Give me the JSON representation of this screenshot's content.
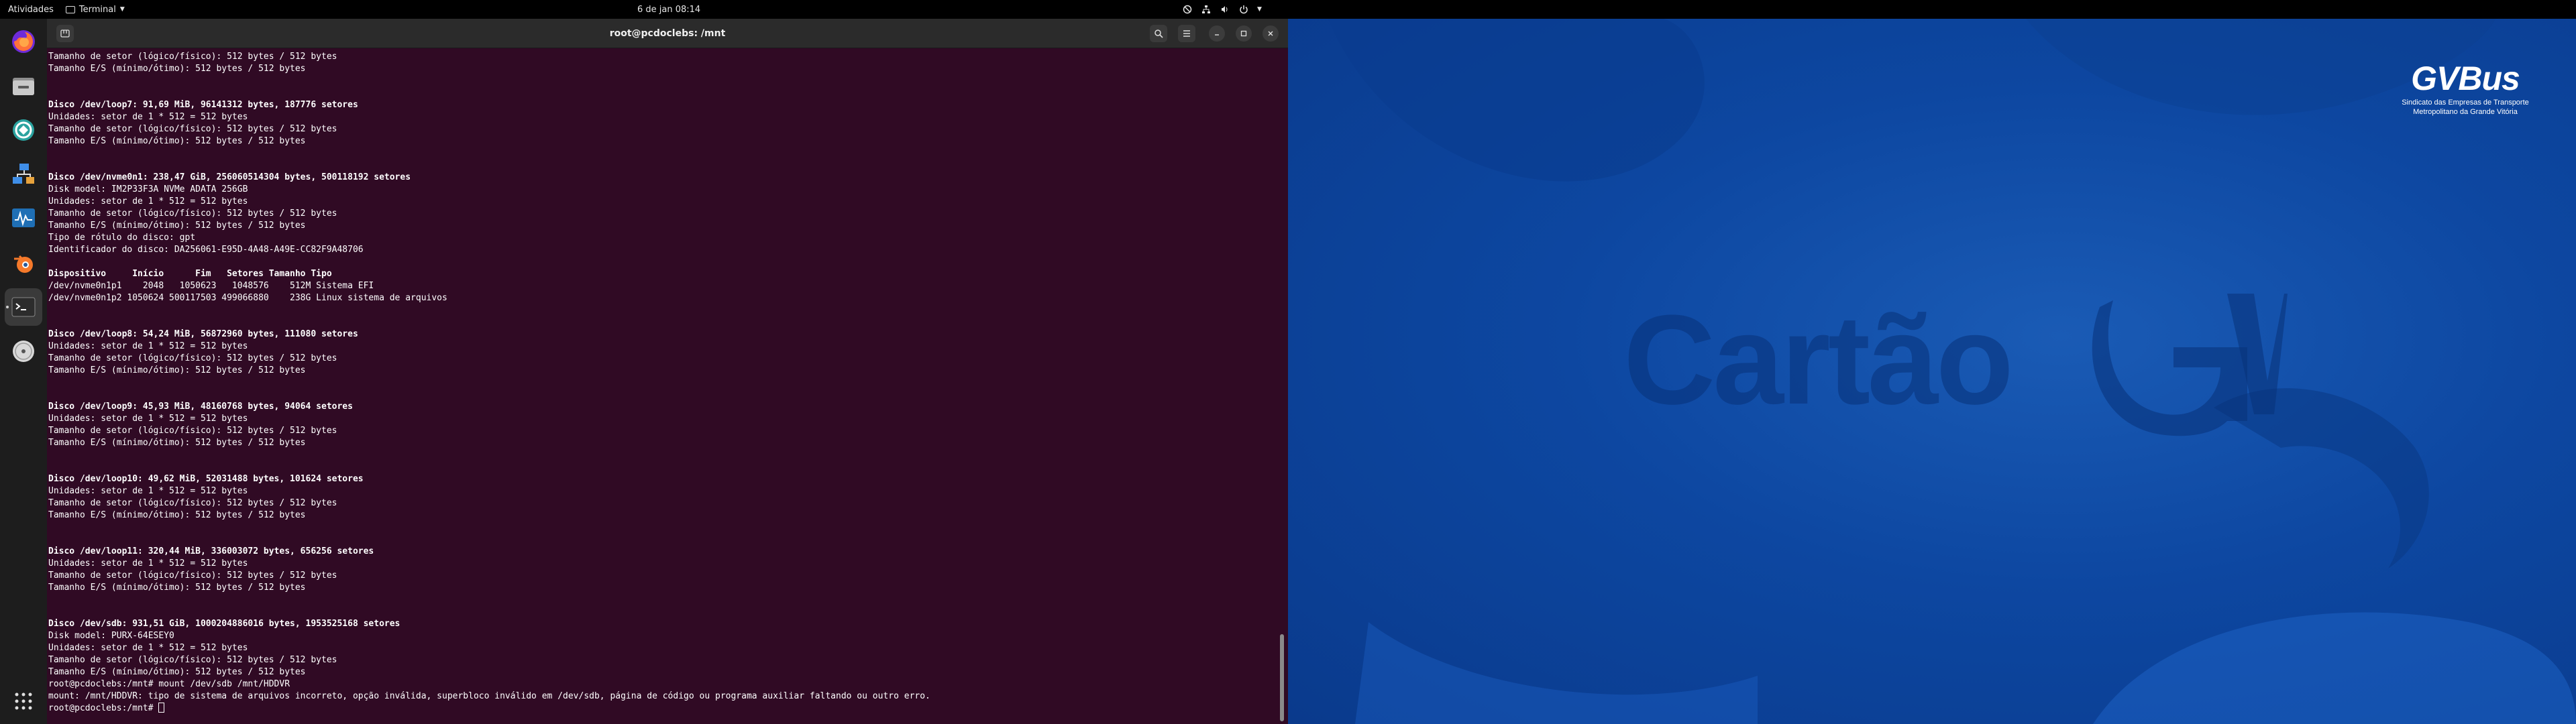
{
  "topbar": {
    "activities": "Atividades",
    "app_name": "Terminal",
    "clock": "6 de jan  08:14"
  },
  "dock": {
    "items": [
      "firefox-icon",
      "files-icon",
      "app-3-icon",
      "network-icon",
      "monitor-icon",
      "blender-icon",
      "terminal-icon",
      "disk-icon"
    ],
    "apps_grid": "show-apps-icon"
  },
  "terminal": {
    "title": "root@pcdoclebs: /mnt",
    "lines": [
      {
        "text": "Tamanho de setor (lógico/físico): 512 bytes / 512 bytes",
        "bold": false
      },
      {
        "text": "Tamanho E/S (mínimo/ótimo): 512 bytes / 512 bytes",
        "bold": false
      },
      {
        "text": "",
        "bold": false
      },
      {
        "text": "",
        "bold": false
      },
      {
        "text": "Disco /dev/loop7: 91,69 MiB, 96141312 bytes, 187776 setores",
        "bold": true
      },
      {
        "text": "Unidades: setor de 1 * 512 = 512 bytes",
        "bold": false
      },
      {
        "text": "Tamanho de setor (lógico/físico): 512 bytes / 512 bytes",
        "bold": false
      },
      {
        "text": "Tamanho E/S (mínimo/ótimo): 512 bytes / 512 bytes",
        "bold": false
      },
      {
        "text": "",
        "bold": false
      },
      {
        "text": "",
        "bold": false
      },
      {
        "text": "Disco /dev/nvme0n1: 238,47 GiB, 256060514304 bytes, 500118192 setores",
        "bold": true
      },
      {
        "text": "Disk model: IM2P33F3A NVMe ADATA 256GB",
        "bold": false
      },
      {
        "text": "Unidades: setor de 1 * 512 = 512 bytes",
        "bold": false
      },
      {
        "text": "Tamanho de setor (lógico/físico): 512 bytes / 512 bytes",
        "bold": false
      },
      {
        "text": "Tamanho E/S (mínimo/ótimo): 512 bytes / 512 bytes",
        "bold": false
      },
      {
        "text": "Tipo de rótulo do disco: gpt",
        "bold": false
      },
      {
        "text": "Identificador do disco: DA256061-E95D-4A48-A49E-CC82F9A48706",
        "bold": false
      },
      {
        "text": "",
        "bold": false
      },
      {
        "text": "Dispositivo     Início      Fim   Setores Tamanho Tipo",
        "bold": true
      },
      {
        "text": "/dev/nvme0n1p1    2048   1050623   1048576    512M Sistema EFI",
        "bold": false
      },
      {
        "text": "/dev/nvme0n1p2 1050624 500117503 499066880    238G Linux sistema de arquivos",
        "bold": false
      },
      {
        "text": "",
        "bold": false
      },
      {
        "text": "",
        "bold": false
      },
      {
        "text": "Disco /dev/loop8: 54,24 MiB, 56872960 bytes, 111080 setores",
        "bold": true
      },
      {
        "text": "Unidades: setor de 1 * 512 = 512 bytes",
        "bold": false
      },
      {
        "text": "Tamanho de setor (lógico/físico): 512 bytes / 512 bytes",
        "bold": false
      },
      {
        "text": "Tamanho E/S (mínimo/ótimo): 512 bytes / 512 bytes",
        "bold": false
      },
      {
        "text": "",
        "bold": false
      },
      {
        "text": "",
        "bold": false
      },
      {
        "text": "Disco /dev/loop9: 45,93 MiB, 48160768 bytes, 94064 setores",
        "bold": true
      },
      {
        "text": "Unidades: setor de 1 * 512 = 512 bytes",
        "bold": false
      },
      {
        "text": "Tamanho de setor (lógico/físico): 512 bytes / 512 bytes",
        "bold": false
      },
      {
        "text": "Tamanho E/S (mínimo/ótimo): 512 bytes / 512 bytes",
        "bold": false
      },
      {
        "text": "",
        "bold": false
      },
      {
        "text": "",
        "bold": false
      },
      {
        "text": "Disco /dev/loop10: 49,62 MiB, 52031488 bytes, 101624 setores",
        "bold": true
      },
      {
        "text": "Unidades: setor de 1 * 512 = 512 bytes",
        "bold": false
      },
      {
        "text": "Tamanho de setor (lógico/físico): 512 bytes / 512 bytes",
        "bold": false
      },
      {
        "text": "Tamanho E/S (mínimo/ótimo): 512 bytes / 512 bytes",
        "bold": false
      },
      {
        "text": "",
        "bold": false
      },
      {
        "text": "",
        "bold": false
      },
      {
        "text": "Disco /dev/loop11: 320,44 MiB, 336003072 bytes, 656256 setores",
        "bold": true
      },
      {
        "text": "Unidades: setor de 1 * 512 = 512 bytes",
        "bold": false
      },
      {
        "text": "Tamanho de setor (lógico/físico): 512 bytes / 512 bytes",
        "bold": false
      },
      {
        "text": "Tamanho E/S (mínimo/ótimo): 512 bytes / 512 bytes",
        "bold": false
      },
      {
        "text": "",
        "bold": false
      },
      {
        "text": "",
        "bold": false
      },
      {
        "text": "Disco /dev/sdb: 931,51 GiB, 1000204886016 bytes, 1953525168 setores",
        "bold": true
      },
      {
        "text": "Disk model: PURX-64ESEY0",
        "bold": false
      },
      {
        "text": "Unidades: setor de 1 * 512 = 512 bytes",
        "bold": false
      },
      {
        "text": "Tamanho de setor (lógico/físico): 512 bytes / 512 bytes",
        "bold": false
      },
      {
        "text": "Tamanho E/S (mínimo/ótimo): 512 bytes / 512 bytes",
        "bold": false
      },
      {
        "text": "root@pcdoclebs:/mnt# mount /dev/sdb /mnt/HDDVR",
        "bold": false
      },
      {
        "text": "mount: /mnt/HDDVR: tipo de sistema de arquivos incorreto, opção inválida, superbloco inválido em /dev/sdb, página de código ou programa auxiliar faltando ou outro erro.",
        "bold": false
      }
    ],
    "prompt": "root@pcdoclebs:/mnt# "
  },
  "desktop": {
    "logo_wordmark": "GVBus",
    "logo_tagline_1": "Sindicato das Empresas de Transporte",
    "logo_tagline_2": "Metropolitano da Grande Vitória",
    "watermark_text": "Cartão"
  },
  "colors": {
    "terminal_bg": "#300a24",
    "desktop_bg": "#0d47a1",
    "dock_bg": "#1d1d1d",
    "topbar_bg": "#000000"
  }
}
